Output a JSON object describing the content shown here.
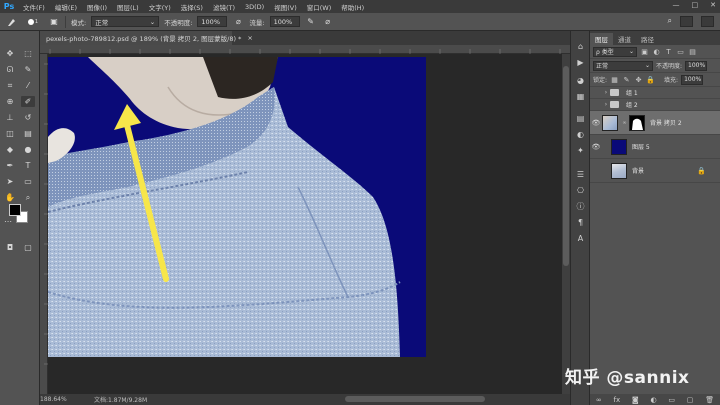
{
  "app": {
    "logo": "Ps"
  },
  "menu": [
    "文件(F)",
    "编辑(E)",
    "图像(I)",
    "图层(L)",
    "文字(Y)",
    "选择(S)",
    "滤镜(T)",
    "3D(D)",
    "视图(V)",
    "窗口(W)",
    "帮助(H)"
  ],
  "window_controls": {
    "minimize": "—",
    "maximize": "□",
    "close": "✕"
  },
  "options_bar": {
    "mode_label": "模式:",
    "mode_value": "正常",
    "opacity_label": "不透明度:",
    "opacity_value": "100%",
    "flow_label": "流量:",
    "flow_value": "100%",
    "brush_size": "1"
  },
  "document_tab": {
    "title": "pexels-photo-789812.psd @ 189% (背景 拷贝 2, 图层蒙版/8) *",
    "close": "×"
  },
  "status_bar": {
    "zoom": "188.64%",
    "doc_info": "文档:1.87M/9.28M"
  },
  "layers_panel": {
    "tabs": [
      "图层",
      "通道",
      "路径"
    ],
    "filter_value": "ρ 类型",
    "blend_mode": "正常",
    "opacity_label": "不透明度:",
    "opacity_value": "100%",
    "lock_label": "锁定:",
    "fill_label": "填充:",
    "fill_value": "100%",
    "layers": [
      {
        "name": "组 1",
        "kind": "group"
      },
      {
        "name": "组 2",
        "kind": "group"
      },
      {
        "name": "背景 拷贝 2",
        "kind": "masked",
        "selected": true
      },
      {
        "name": "图层 5",
        "kind": "solid",
        "color": "#0a0a78"
      },
      {
        "name": "背景",
        "kind": "locked"
      }
    ],
    "footer_icons": [
      "link-icon",
      "fx-icon",
      "mask-icon",
      "adjustment-icon",
      "folder-icon",
      "new-layer-icon",
      "trash-icon"
    ]
  },
  "watermark": "知乎 @sannix",
  "colors": {
    "canvas_bg": "#0a0a78",
    "arrow": "#f7e64a",
    "denim": "#a9bbd6"
  }
}
